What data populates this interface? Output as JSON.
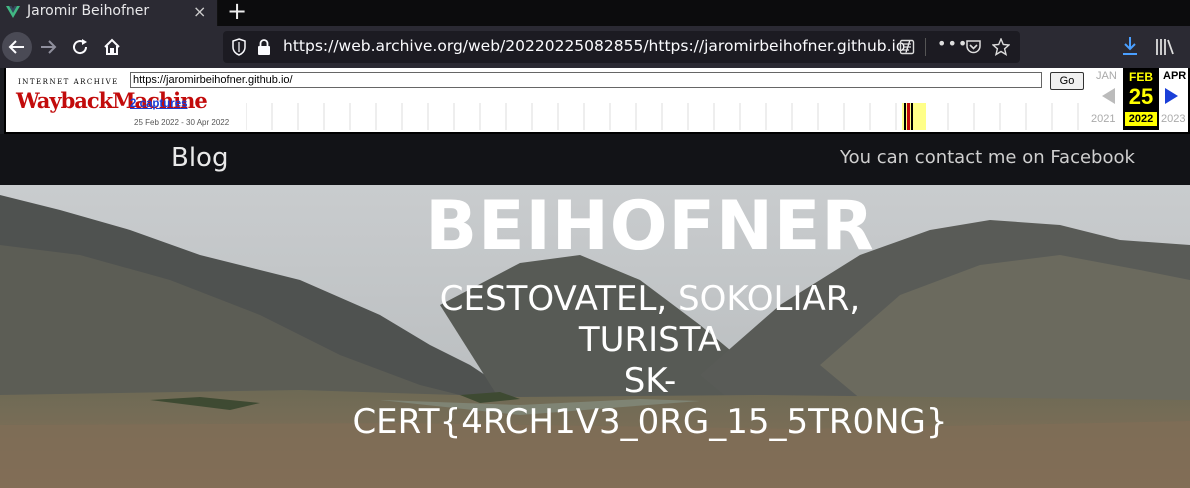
{
  "browser": {
    "tab_title": "Jaromir Beihofner",
    "tab_close": "×",
    "new_tab": "+",
    "url": "https://web.archive.org/web/20220225082855/https://jaromirbeihofner.github.io/",
    "more_actions": "•••"
  },
  "wayback": {
    "ia_label": "INTERNET ARCHIVE",
    "logo_text": "WaybackMachine",
    "url_value": "https://jaromirbeihofner.github.io/",
    "go_label": "Go",
    "captures_label": "2 captures",
    "date_range": "25 Feb 2022 - 30 Apr 2022",
    "prev_month": "JAN",
    "prev_year": "2021",
    "cur_month": "FEB",
    "cur_day": "25",
    "cur_year": "2022",
    "next_month": "APR",
    "next_year": "2023"
  },
  "site": {
    "nav_blog": "Blog",
    "nav_contact": "You can contact me on Facebook",
    "hero_title": "BEIHOFNER",
    "hero_subtitle_lines": [
      "CESTOVATEL, SOKOLIAR,",
      "TURISTA",
      "SK-",
      "CERT{4RCH1V3_0RG_15_5TR0NG}"
    ]
  },
  "colors": {
    "wayback_red": "#c20b0b",
    "highlight_yellow": "#ffff00",
    "capture_link": "#1a3fd8",
    "download_blue": "#4a9fff"
  },
  "icons": [
    "vue-logo-icon",
    "back-arrow-icon",
    "forward-arrow-icon",
    "reload-icon",
    "home-icon",
    "shield-icon",
    "lock-icon",
    "reader-view-icon",
    "pocket-icon",
    "bookmark-star-icon",
    "download-icon",
    "library-icon"
  ]
}
